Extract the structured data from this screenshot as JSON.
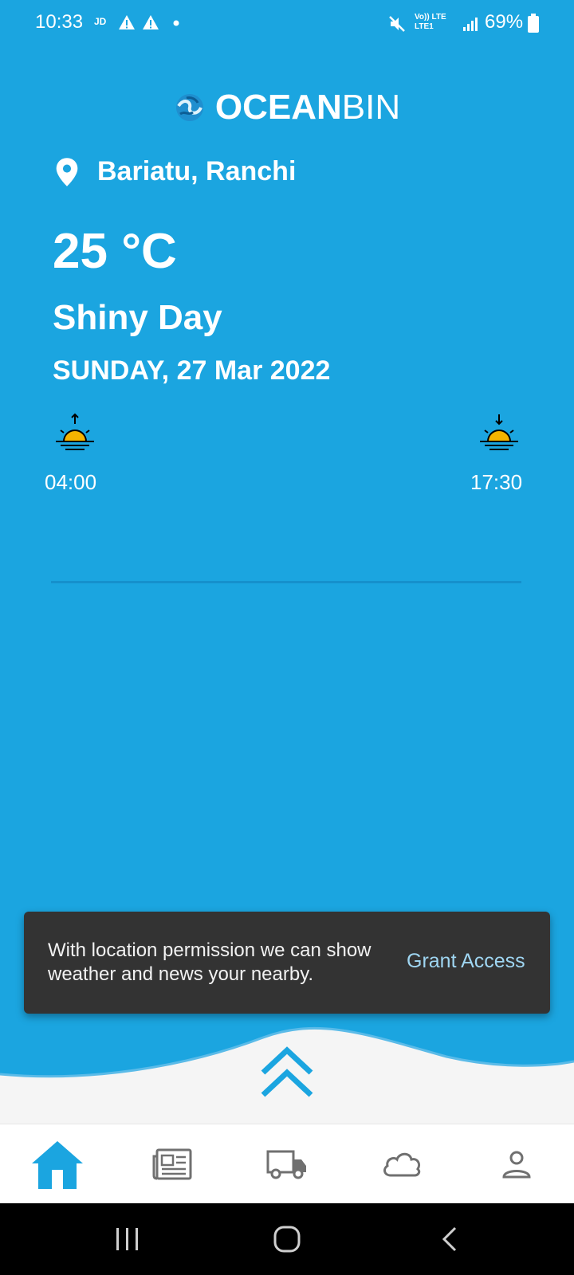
{
  "status_bar": {
    "time": "10:33",
    "carrier_tag": "JD",
    "network_top": "Vo)) LTE",
    "network_bottom": "LTE1",
    "battery": "69%"
  },
  "app": {
    "brand_bold": "OCEAN",
    "brand_light": "BIN"
  },
  "weather": {
    "location": "Bariatu, Ranchi",
    "temperature": "25 °C",
    "condition": "Shiny Day",
    "date": "SUNDAY, 27 Mar 2022",
    "sunrise": "04:00",
    "sunset": "17:30"
  },
  "snackbar": {
    "message": "With location permission we can show weather and news your nearby.",
    "action": "Grant Access"
  },
  "bottom_nav": {
    "items": [
      {
        "icon": "home-icon",
        "active": true
      },
      {
        "icon": "newspaper-icon",
        "active": false
      },
      {
        "icon": "truck-icon",
        "active": false
      },
      {
        "icon": "cloud-icon",
        "active": false
      },
      {
        "icon": "person-icon",
        "active": false
      }
    ]
  },
  "colors": {
    "background": "#1ba5e0",
    "accent": "#1ba5e0",
    "snackbar": "#333333",
    "action": "#9fd6f2",
    "sun": "#f5b400"
  }
}
